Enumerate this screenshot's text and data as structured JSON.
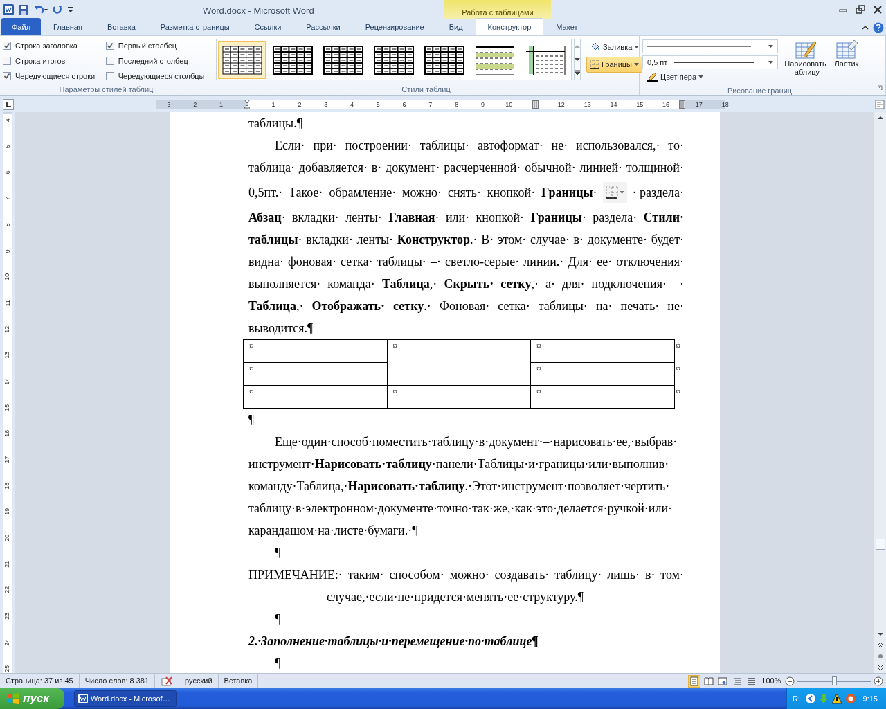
{
  "window": {
    "title": "Word.docx  -  Microsoft Word",
    "context_group": "Работа с таблицами"
  },
  "ribbon_tabs": [
    {
      "label": "Файл",
      "kind": "file",
      "selected": false
    },
    {
      "label": "Главная",
      "kind": "normal",
      "selected": false
    },
    {
      "label": "Вставка",
      "kind": "normal",
      "selected": false
    },
    {
      "label": "Разметка страницы",
      "kind": "normal",
      "selected": false
    },
    {
      "label": "Ссылки",
      "kind": "normal",
      "selected": false
    },
    {
      "label": "Рассылки",
      "kind": "normal",
      "selected": false
    },
    {
      "label": "Рецензирование",
      "kind": "normal",
      "selected": false
    },
    {
      "label": "Вид",
      "kind": "normal",
      "selected": false
    },
    {
      "label": "Конструктор",
      "kind": "context",
      "selected": true
    },
    {
      "label": "Макет",
      "kind": "context",
      "selected": false
    }
  ],
  "style_options": {
    "label": "Параметры стилей таблиц",
    "options": [
      {
        "label": "Строка заголовка",
        "checked": true
      },
      {
        "label": "Строка итогов",
        "checked": false
      },
      {
        "label": "Чередующиеся строки",
        "checked": true
      },
      {
        "label": "Первый столбец",
        "checked": true
      },
      {
        "label": "Последний столбец",
        "checked": false
      },
      {
        "label": "Чередующиеся столбцы",
        "checked": false
      }
    ]
  },
  "table_styles": {
    "label": "Стили таблиц",
    "styles": [
      {
        "kind": "light-grid",
        "selected": true
      },
      {
        "kind": "grid",
        "selected": false
      },
      {
        "kind": "grid",
        "selected": false
      },
      {
        "kind": "grid",
        "selected": false
      },
      {
        "kind": "grid",
        "selected": false
      },
      {
        "kind": "banded-rows",
        "selected": false
      },
      {
        "kind": "banded-columns",
        "selected": false
      }
    ],
    "shading": {
      "label": "Заливка"
    },
    "borders": {
      "label": "Границы",
      "selected": true
    }
  },
  "draw_borders": {
    "label": "Рисование границ",
    "line_weight": "0,5 пт",
    "pen_color": "Цвет пера",
    "buttons": [
      {
        "label": "Нарисовать таблицу",
        "kind": "pencil"
      },
      {
        "label": "Ластик",
        "kind": "eraser"
      }
    ]
  },
  "ruler": {
    "marks": [
      {
        "kind": "number",
        "text": "3"
      },
      {
        "kind": "number",
        "text": "2"
      },
      {
        "kind": "number",
        "text": "1"
      },
      {
        "kind": "indent-marker"
      },
      {
        "kind": "number",
        "text": "1"
      },
      {
        "kind": "number",
        "text": "2"
      },
      {
        "kind": "number",
        "text": "3"
      },
      {
        "kind": "number",
        "text": "4"
      },
      {
        "kind": "number",
        "text": "5"
      },
      {
        "kind": "number",
        "text": "6"
      },
      {
        "kind": "number",
        "text": "7"
      },
      {
        "kind": "number",
        "text": "8"
      },
      {
        "kind": "number",
        "text": "9"
      },
      {
        "kind": "number",
        "text": "10"
      },
      {
        "kind": "column-marker"
      },
      {
        "kind": "number",
        "text": "12"
      },
      {
        "kind": "number",
        "text": "13"
      },
      {
        "kind": "number",
        "text": "14"
      },
      {
        "kind": "number",
        "text": "15"
      },
      {
        "kind": "number",
        "text": "16"
      },
      {
        "kind": "column-marker"
      },
      {
        "kind": "number",
        "text": "17"
      },
      {
        "kind": "number",
        "text": "18"
      }
    ],
    "vertical_numbers": [
      "4",
      "5",
      "6",
      "7",
      "8",
      "9",
      "10",
      "11",
      "12",
      "13",
      "14",
      "15",
      "16",
      "17",
      "18",
      "19",
      "20",
      "21",
      "22",
      "23",
      "24",
      "25"
    ]
  },
  "document": {
    "blocks": [
      {
        "kind": "cut",
        "text": "таблицы.¶"
      },
      {
        "kind": "body",
        "parts": [
          {
            "kind": "line",
            "text": "Если· при· построении· таблицы· автоформат· не· использовался,· то·"
          },
          {
            "kind": "line",
            "text": "таблица· добавляется· в· документ· расчерченной· обычной· линией· толщиной·"
          },
          {
            "kind": "inline-text",
            "text": "0,5пт.· Такое· обрамление· можно· снять· кнопкой· **Границы**·"
          },
          {
            "kind": "borders-button"
          },
          {
            "kind": "inline-text",
            "text": "· раздела·"
          },
          {
            "kind": "text",
            "text": "**Абзац**· вкладки· ленты· **Главная**· или· кнопкой· **Границы**· раздела· **Стили· таблицы**· вкладки· ленты· **Конструктор**.· В· этом· случае· в· документе· будет· видна· фоновая· сетка· таблицы· –· светло-серые· линии.· Для· ее· отключения· выполняется· команда· **Таблица**,· **Скрыть· сетку**,· а· для· подключения· –· **Таблица**,· **Отображать· сетку**.· Фоновая· сетка· таблицы· на· печать· не· выводится.¶"
          }
        ]
      },
      {
        "kind": "table",
        "row_end": "¤",
        "rows": [
          [
            {
              "text": "¤"
            },
            {
              "text": "¤",
              "rowspan": 2
            },
            {
              "text": "¤"
            }
          ],
          [
            {
              "text": "¤"
            },
            {
              "text": "¤"
            }
          ],
          [
            {
              "text": "¤"
            },
            {
              "text": "¤"
            },
            {
              "text": "¤"
            }
          ]
        ]
      },
      {
        "kind": "plain",
        "text": "¶"
      },
      {
        "kind": "body-tight",
        "text": "Еще·один·способ·поместить·таблицу·в·документ·–·нарисовать·ее,·выбрав·инструмент·**Нарисовать·таблицу**·панели·Таблицы·и·границы·или·выполнив·команду·Таблица,·**Нарисовать·таблицу**.·Этот·инструмент·позволяет·чертить·таблицу·в·электронном·документе·точно·так·же,·как·это·делается·ручкой·или·карандашом·на·листе·бумаги.·¶"
      },
      {
        "kind": "indented",
        "text": "¶"
      },
      {
        "kind": "hanging",
        "text": "ПРИМЕЧАНИЕ:· таким· способом· можно· создавать· таблицу· лишь· в· том· случае,·если·не·придется·менять·ее·структуру.¶"
      },
      {
        "kind": "indented",
        "text": "¶"
      },
      {
        "kind": "heading",
        "text": "2.·Заполнение·таблицы·и·перемещение·по·таблице¶"
      },
      {
        "kind": "indented",
        "text": "¶"
      }
    ]
  },
  "status_bar": {
    "page": "Страница: 37 из 45",
    "words": "Число слов: 8 381",
    "language": "русский",
    "mode": "Вставка",
    "views": [
      {
        "selected": true
      },
      {
        "selected": false
      },
      {
        "selected": false
      },
      {
        "selected": false
      },
      {
        "selected": false
      }
    ],
    "zoom": "100%",
    "zoom_level": {
      "level": 0.5
    }
  },
  "taskbar": {
    "start": "пуск",
    "tasks": [
      {
        "label": "Word.docx - Microsof…",
        "selected": true
      }
    ],
    "language": "RL",
    "clock": "9:15"
  }
}
